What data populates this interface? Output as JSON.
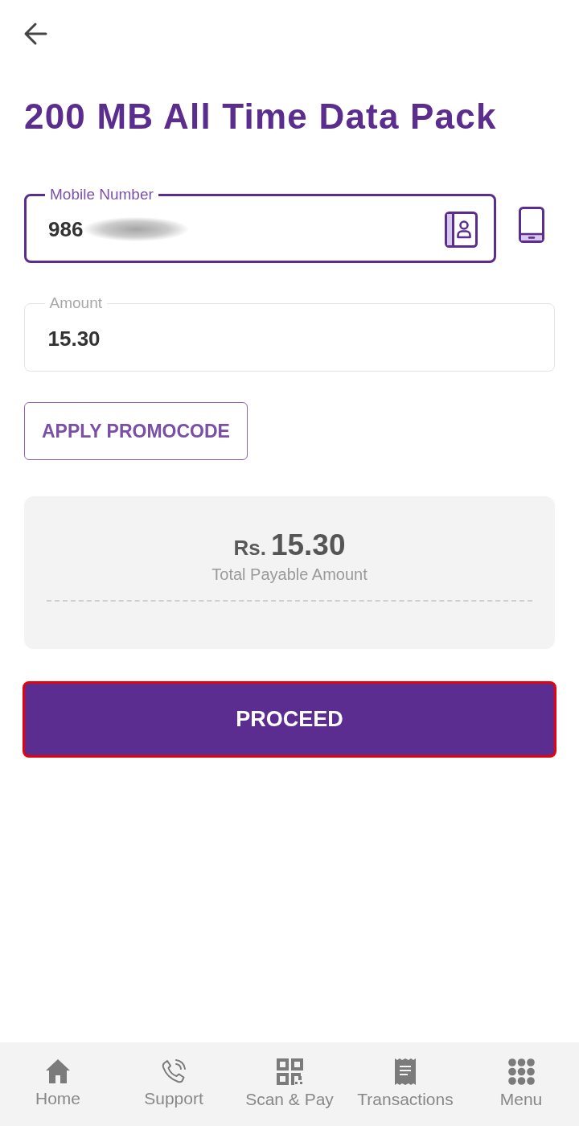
{
  "title": "200 MB All Time Data Pack",
  "fields": [
    {
      "kind": "phone",
      "label": "Mobile Number",
      "value": "986",
      "focused": true,
      "masked": true
    },
    {
      "kind": "amount",
      "label": "Amount",
      "value": "15.30",
      "focused": false,
      "masked": false
    }
  ],
  "promo_button": "APPLY PROMOCODE",
  "summary": {
    "currency": "Rs.",
    "amount": "15.30",
    "caption": "Total Payable Amount"
  },
  "proceed": {
    "label": "PROCEED",
    "highlighted": true
  },
  "nav": [
    {
      "kind": "home",
      "label": "Home",
      "selected": false
    },
    {
      "kind": "support",
      "label": "Support",
      "selected": false
    },
    {
      "kind": "scan",
      "label": "Scan & Pay",
      "selected": false
    },
    {
      "kind": "transactions",
      "label": "Transactions",
      "selected": false
    },
    {
      "kind": "menu",
      "label": "Menu",
      "selected": false
    }
  ]
}
